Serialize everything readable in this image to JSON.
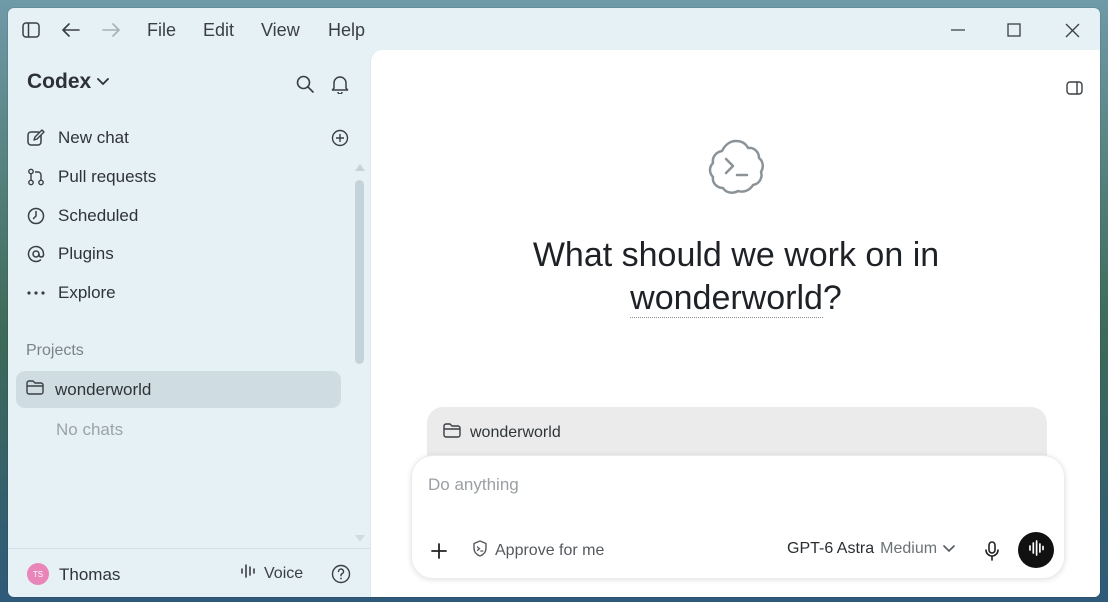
{
  "menu": {
    "file": "File",
    "edit": "Edit",
    "view": "View",
    "help": "Help"
  },
  "sidebar": {
    "app_name": "Codex",
    "nav": [
      {
        "label": "New chat",
        "icon": "new-chat-icon"
      },
      {
        "label": "Pull requests",
        "icon": "pull-request-icon"
      },
      {
        "label": "Scheduled",
        "icon": "clock-icon"
      },
      {
        "label": "Plugins",
        "icon": "at-sign-icon"
      },
      {
        "label": "Explore",
        "icon": "more-dots-icon"
      }
    ],
    "projects_label": "Projects",
    "project": "wonderworld",
    "no_chats": "No chats"
  },
  "footer": {
    "avatar_initials": "TS",
    "user": "Thomas",
    "voice": "Voice"
  },
  "main": {
    "title_prefix": "What should we work on in",
    "title_project": "wonderworld",
    "title_suffix": "?",
    "context_project": "wonderworld",
    "composer_placeholder": "Do anything",
    "approve_label": "Approve for me",
    "model_name": "GPT-6 Astra",
    "model_effort": "Medium"
  },
  "colors": {
    "sidebar_bg": "#e6f1f5",
    "project_highlight": "#cfdde3",
    "send_button": "#111111",
    "avatar": "#e985b9"
  }
}
